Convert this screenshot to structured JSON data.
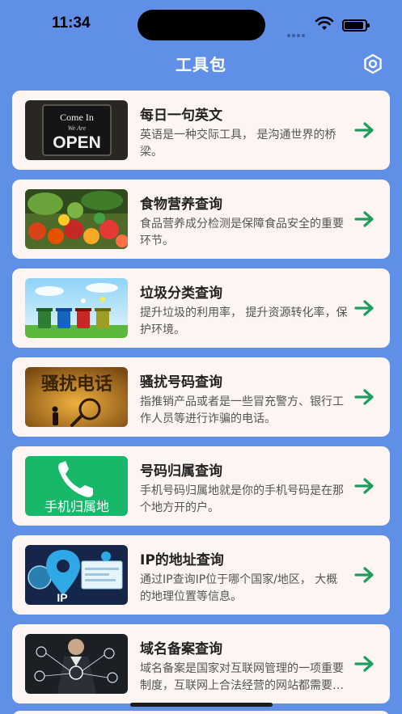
{
  "status_bar": {
    "time": "11:34"
  },
  "header": {
    "title": "工具包"
  },
  "tools": [
    {
      "title": "每日一句英文",
      "desc": "英语是一种交际工具， 是沟通世界的桥梁。",
      "thumb_text_1": "Come In",
      "thumb_text_2": "We Are",
      "thumb_text_3": "OPEN"
    },
    {
      "title": "食物营养查询",
      "desc": "食品营养成分检测是保障食品安全的重要环节。"
    },
    {
      "title": "垃圾分类查询",
      "desc": "提升垃圾的利用率， 提升资源转化率，保护环境。"
    },
    {
      "title": "骚扰号码查询",
      "desc": "指推销产品或者是一些冒充警方、银行工作人员等进行诈骗的电话。",
      "thumb_text": "骚扰电话"
    },
    {
      "title": "号码归属查询",
      "desc": "手机号码归属地就是你的手机号码是在那个地方开的户。",
      "thumb_text": "手机归属地"
    },
    {
      "title": "IP的地址查询",
      "desc": "通过IP查询IP位于哪个国家/地区， 大概的地理位置等信息。",
      "thumb_text": "IP"
    },
    {
      "title": "域名备案查询",
      "desc": "域名备案是国家对互联网管理的一项重要制度，互联网上合法经营的网站都需要备案。"
    }
  ],
  "colors": {
    "background": "#5f8fe6",
    "card": "#fcf5f1",
    "arrow": "#1e9e5e"
  },
  "icons": {
    "settings": "hexagon-settings-icon",
    "arrow": "arrow-right-icon"
  }
}
